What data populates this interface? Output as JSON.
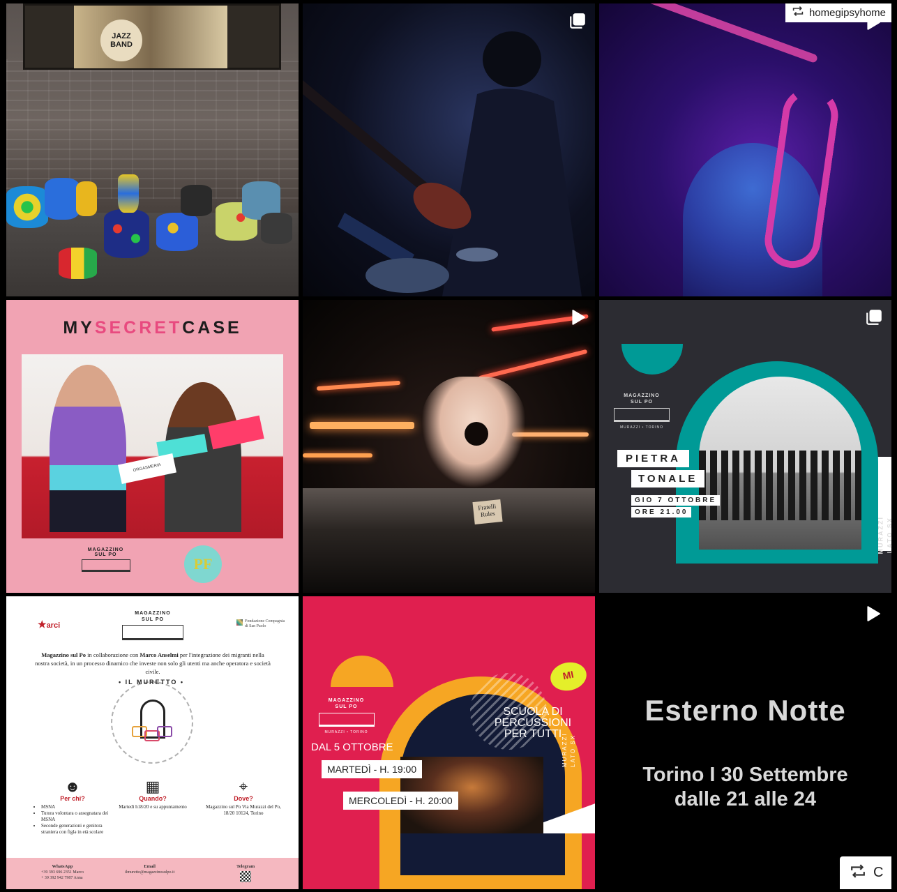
{
  "tiles": {
    "jazz": {
      "poster_text": "JAZZ BAND",
      "badge": ""
    },
    "bass": {
      "badge": "multi-photo-icon"
    },
    "sax": {
      "repost_user": "homegipsyhome",
      "badge": "play-icon"
    },
    "secretcase": {
      "title_a": "MY",
      "title_b": "SECRET",
      "title_c": "CASE",
      "box_label": "ORGASMERIA",
      "logo_line1": "MAGAZZINO",
      "logo_line2": "SUL PO",
      "pf": "PF"
    },
    "hands": {
      "badge": "play-icon",
      "sticker": "Fratelli Rules"
    },
    "pietra": {
      "badge": "multi-photo-icon",
      "mag_line1": "MAGAZZINO",
      "mag_line2": "SUL PO",
      "mag_sub": "MURAZZI • TORINO",
      "label1": "PIETRA",
      "label2": "TONALE",
      "date": "GIO 7 OTTOBRE",
      "time": "ORE 21.00",
      "vert1": "MURAZZI",
      "vert2": "LATO SX"
    },
    "muretto": {
      "arci": "arci",
      "mag_line1": "MAGAZZINO",
      "mag_line2": "SUL PO",
      "fondazione": "Fondazione Compagnia di San Paolo",
      "intro_1": "Magazzino sul Po",
      "intro_2": " in collaborazione con ",
      "intro_3": "Marco Anselmi",
      "intro_4": "per l'integrazione dei migranti nella nostra società, in un processo dinamico che investe non solo gli utenti ma anche operatora e società civile.",
      "circle_text": "• IL MURETTO •",
      "per_chi": "Per chi?",
      "per_chi_items": [
        "MSNA",
        "Tutora volontara o assegnatara dei MSNA",
        "Seconde generazioni e genitora straniera con figlə in età scolare"
      ],
      "quando": "Quando?",
      "quando_text": "Martedì h18/20 e su appuntamento",
      "dove": "Dove?",
      "dove_text": "Magazzino sul Po Via Murazzi del Po, 18/20 10124, Torino",
      "whatsapp_h": "WhatsApp",
      "whatsapp_1": "+39 393 696 2351  Marco",
      "whatsapp_2": "+ 39 392 942 7987 Anna",
      "email_h": "Email",
      "email": "ilmuretto@magazzinosulpo.it",
      "telegram_h": "Telegram"
    },
    "scuola": {
      "mag_line1": "MAGAZZINO",
      "mag_line2": "SUL PO",
      "mag_sub": "MURAZZI • TORINO",
      "head1": "SCUOLA DI",
      "head2": "PERCUSSIONI",
      "head3": "PER TUTTI",
      "dal": "DAL 5 OTTOBRE",
      "mar": "MARTEDÌ - H. 19:00",
      "mer": "MERCOLEDÌ - H. 20:00",
      "vert1": "MURAZZI",
      "vert2": "LATO SX",
      "mistura": "MI"
    },
    "esterno": {
      "badge": "play-icon",
      "title": "Esterno Notte",
      "line1": "Torino I 30 Settembre",
      "line2": "dalle 21 alle 24",
      "repost_text": "C"
    }
  }
}
